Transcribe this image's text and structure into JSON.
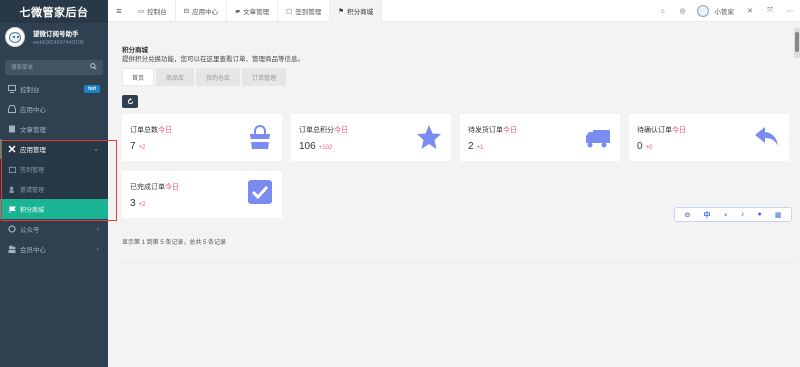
{
  "brand": {
    "title": "七微管家后台"
  },
  "profile": {
    "name": "望微订阅号助手",
    "id": "wxb59f24697449196"
  },
  "search": {
    "placeholder": "搜索菜单"
  },
  "sidebar": {
    "items": [
      {
        "label": "控制台",
        "icon": "monitor-icon",
        "badge": "hot"
      },
      {
        "label": "应用中心",
        "icon": "inbox-icon"
      },
      {
        "label": "文章管理",
        "icon": "book-icon"
      },
      {
        "label": "应用管理",
        "icon": "gear-icon"
      }
    ],
    "sub_items": [
      {
        "label": "签到管理",
        "icon": "calendar-icon"
      },
      {
        "label": "邀请管理",
        "icon": "users-icon"
      },
      {
        "label": "积分商城",
        "icon": "flag-icon"
      }
    ],
    "tail_items": [
      {
        "label": "公众号",
        "icon": "circle-icon"
      },
      {
        "label": "会员中心",
        "icon": "users-icon"
      }
    ]
  },
  "topbar": {
    "tabs": [
      {
        "label": "控制台",
        "icon": "monitor-icon"
      },
      {
        "label": "应用中心",
        "icon": "inbox-icon"
      },
      {
        "label": "文章管理",
        "icon": "book-icon"
      },
      {
        "label": "签到管理",
        "icon": "calendar-icon"
      },
      {
        "label": "积分商城",
        "icon": "flag-icon"
      }
    ],
    "user": "小管家"
  },
  "main": {
    "title": "积分商城",
    "description": "提供积分兑换功能，您可以在这里查看订单、管理商品等信息。",
    "tabs": [
      "首页",
      "商品库",
      "我的仓库",
      "订单管理"
    ],
    "today_label": "今日",
    "pager_text": "显示第 1 到第 5 条记录，总共 5 条记录"
  },
  "stats": [
    {
      "label": "订单总数",
      "value": "7",
      "delta": "+2",
      "icon": "shopping-bag-icon"
    },
    {
      "label": "订单总积分",
      "value": "106",
      "delta": "+102",
      "icon": "star-icon"
    },
    {
      "label": "待发货订单",
      "value": "2",
      "delta": "+1",
      "icon": "truck-icon"
    },
    {
      "label": "待确认订单",
      "value": "0",
      "delta": "+0",
      "icon": "reply-arrow-icon"
    },
    {
      "label": "已完成订单",
      "value": "3",
      "delta": "+2",
      "icon": "check-square-icon"
    }
  ],
  "floatbar": {
    "lang": "中"
  },
  "colors": {
    "sidebar": "#2f4050",
    "accent": "#1ab394",
    "icon": "#7b8cf0",
    "today": "#ed5565"
  }
}
